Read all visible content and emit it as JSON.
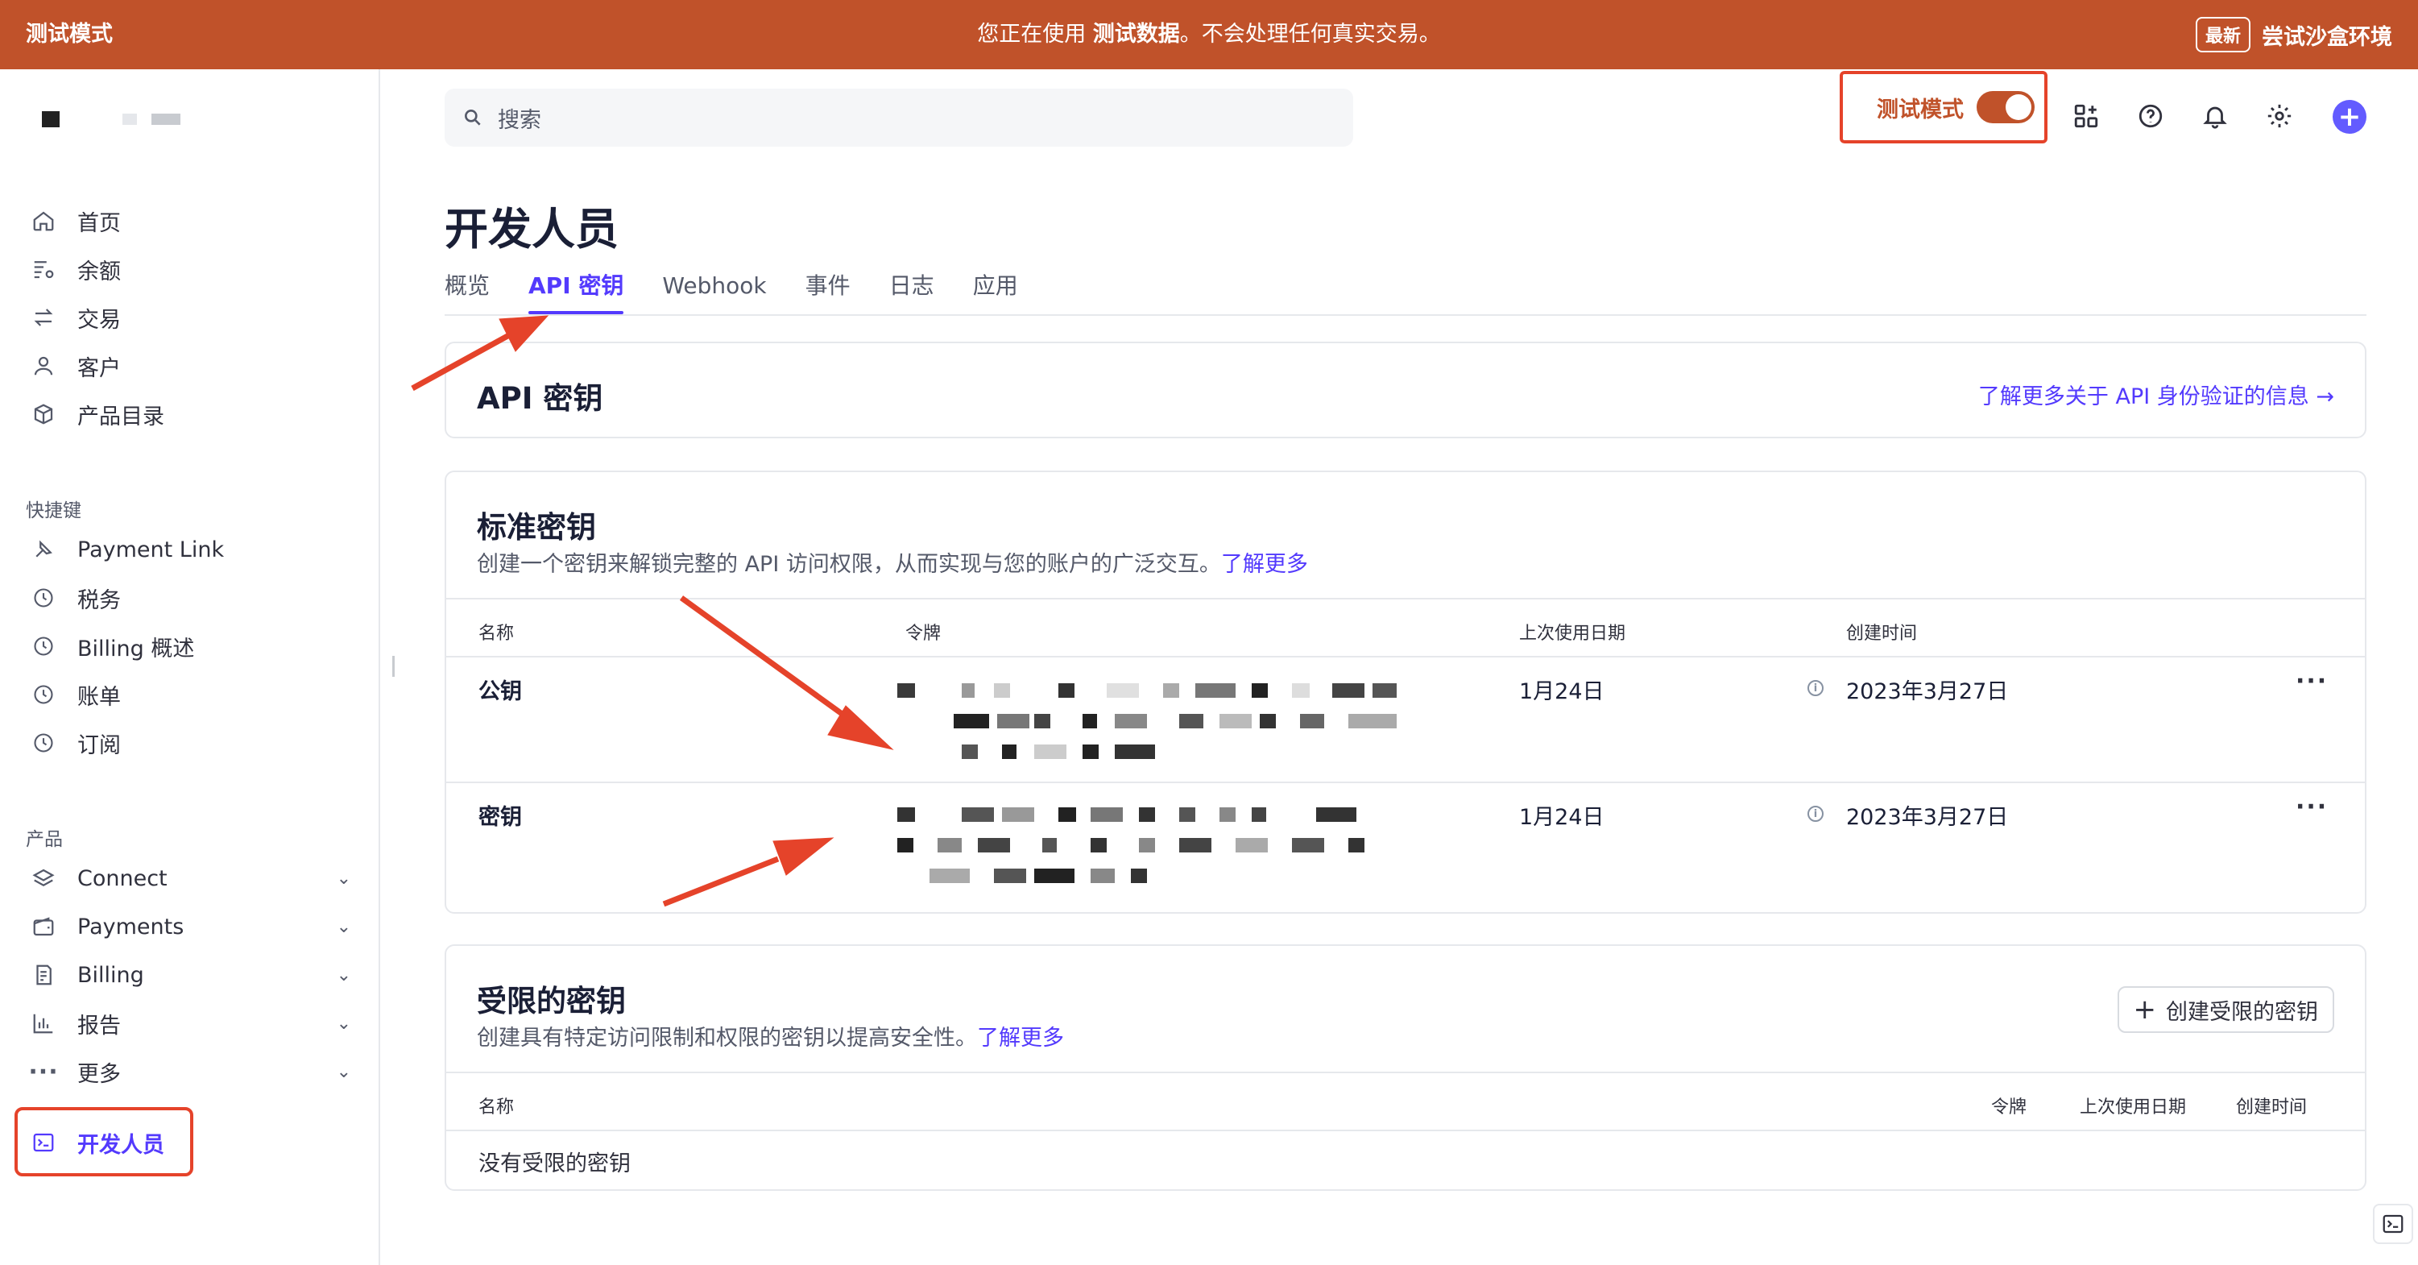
{
  "banner": {
    "mode_label": "测试模式",
    "message_prefix": "您正在使用",
    "message_bold": "测试数据",
    "message_suffix": "。不会处理任何真实交易。",
    "badge": "最新",
    "sandbox_link": "尝试沙盒环境"
  },
  "sidebar": {
    "main_items": [
      {
        "label": "首页",
        "icon": "home-icon"
      },
      {
        "label": "余额",
        "icon": "balance-icon"
      },
      {
        "label": "交易",
        "icon": "transactions-icon"
      },
      {
        "label": "客户",
        "icon": "customer-icon"
      },
      {
        "label": "产品目录",
        "icon": "product-catalog-icon"
      }
    ],
    "shortcuts_label": "快捷键",
    "shortcuts": [
      {
        "label": "Payment Link",
        "icon": "payment-link-icon"
      },
      {
        "label": "税务",
        "icon": "clock-icon"
      },
      {
        "label": "Billing 概述",
        "icon": "clock-icon"
      },
      {
        "label": "账单",
        "icon": "clock-icon"
      },
      {
        "label": "订阅",
        "icon": "clock-icon"
      }
    ],
    "products_label": "产品",
    "products": [
      {
        "label": "Connect",
        "icon": "layers-icon"
      },
      {
        "label": "Payments",
        "icon": "wallet-icon"
      },
      {
        "label": "Billing",
        "icon": "billing-icon"
      },
      {
        "label": "报告",
        "icon": "bar-chart-icon"
      },
      {
        "label": "更多",
        "icon": "more-dots-icon"
      }
    ],
    "developer_label": "开发人员"
  },
  "topbar": {
    "search_placeholder": "搜索",
    "test_mode_label": "测试模式",
    "test_mode_on": true
  },
  "page": {
    "title": "开发人员",
    "tabs": [
      "概览",
      "API 密钥",
      "Webhook",
      "事件",
      "日志",
      "应用"
    ],
    "active_tab": "API 密钥"
  },
  "api_keys_card": {
    "title": "API 密钥",
    "learn_more": "了解更多关于 API 身份验证的信息 →"
  },
  "standard_keys": {
    "title": "标准密钥",
    "description": "创建一个密钥来解锁完整的 API 访问权限，从而实现与您的账户的广泛交互。",
    "learn_more": "了解更多",
    "columns": [
      "名称",
      "令牌",
      "上次使用日期",
      "创建时间"
    ],
    "rows": [
      {
        "name": "公钥",
        "last_used": "1月24日",
        "created": "2023年3月27日"
      },
      {
        "name": "密钥",
        "last_used": "1月24日",
        "created": "2023年3月27日"
      }
    ]
  },
  "restricted_keys": {
    "title": "受限的密钥",
    "description": "创建具有特定访问限制和权限的密钥以提高安全性。",
    "learn_more": "了解更多",
    "create_button": "创建受限的密钥",
    "columns": [
      "名称",
      "令牌",
      "上次使用日期",
      "创建时间"
    ],
    "empty_text": "没有受限的密钥"
  },
  "colors": {
    "banner": "#c0522a",
    "accent": "#533afd",
    "annotation": "#e5432a"
  }
}
